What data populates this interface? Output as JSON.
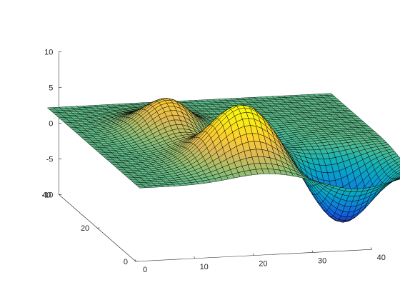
{
  "chart_data": {
    "type": "surface",
    "title": "",
    "xlabel": "",
    "ylabel": "",
    "zlabel": "",
    "xlim": [
      0,
      40
    ],
    "ylim": [
      0,
      40
    ],
    "zlim": [
      -10,
      10
    ],
    "x_ticks": [
      0,
      10,
      20,
      30,
      40
    ],
    "y_ticks": [
      0,
      20,
      40
    ],
    "z_ticks": [
      -10,
      -5,
      0,
      5,
      10
    ],
    "x_tick_labels": [
      "0",
      "10",
      "20",
      "30",
      "40"
    ],
    "y_tick_labels": [
      "0",
      "20",
      "40"
    ],
    "z_tick_labels": [
      "-10",
      "-5",
      "0",
      "5",
      "10"
    ],
    "grid": false,
    "colormap": "parula",
    "mesh": {
      "x_range": [
        1,
        49
      ],
      "y_range": [
        1,
        49
      ],
      "count": 49
    },
    "features": [
      {
        "type": "peak",
        "x": 22,
        "y": 12,
        "z": 8.2,
        "sx": 5.5,
        "sy": 5.5
      },
      {
        "type": "peak",
        "x": 16,
        "y": 30,
        "z": 5.8,
        "sx": 4.5,
        "sy": 6
      },
      {
        "type": "trough",
        "x": 38,
        "y": 10,
        "z": -8.5,
        "sx": 5,
        "sy": 5
      },
      {
        "type": "trough",
        "x": 22,
        "y": 26,
        "z": -2.6,
        "sx": 7,
        "sy": 5
      },
      {
        "type": "hole",
        "x": 32,
        "y": 39,
        "z": 6.5
      }
    ],
    "zero_plane": 0
  }
}
